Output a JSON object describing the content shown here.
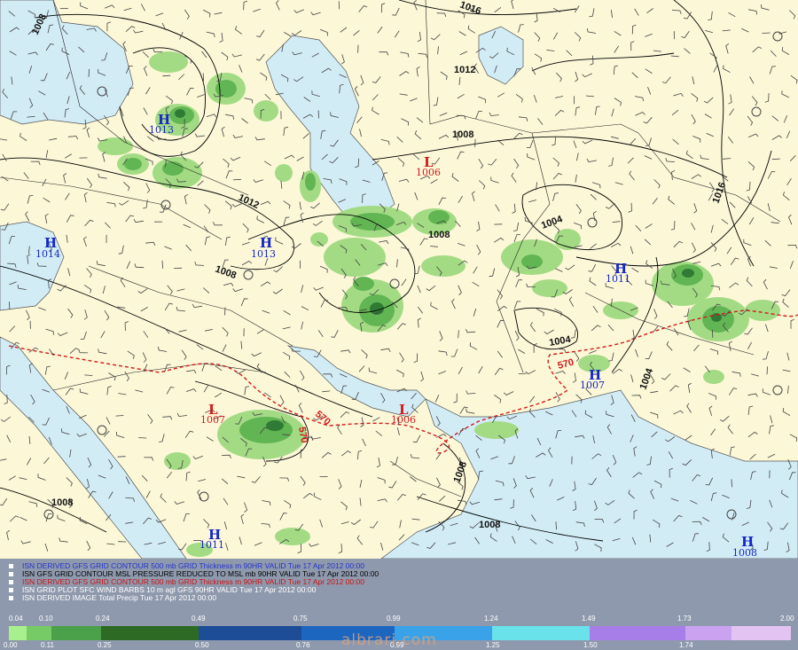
{
  "map": {
    "colors": {
      "land": "#fbf7d7",
      "sea": "#d2ecf6",
      "precip_light": "#a3db84",
      "precip_mid": "#62b553",
      "precip_dark": "#2f7a34",
      "high": "#1426c8",
      "low": "#d21a1a",
      "thickness_570": "#d21a1a"
    },
    "centers": [
      {
        "type": "H",
        "value": "1013"
      },
      {
        "type": "H",
        "value": "1014"
      },
      {
        "type": "H",
        "value": "1013"
      },
      {
        "type": "L",
        "value": "1006"
      },
      {
        "type": "H",
        "value": "1011"
      },
      {
        "type": "H",
        "value": "1007"
      },
      {
        "type": "L",
        "value": "1007"
      },
      {
        "type": "L",
        "value": "1006"
      },
      {
        "type": "H",
        "value": "1011"
      },
      {
        "type": "H",
        "value": "1008"
      }
    ],
    "isobar_labels": [
      "1016",
      "1008",
      "1012",
      "1008",
      "1012",
      "1008",
      "1008",
      "1004",
      "1016",
      "1004",
      "1004",
      "1008",
      "1008",
      "1008"
    ],
    "thickness_labels": [
      "570",
      "570",
      "570"
    ]
  },
  "legend": {
    "lines": [
      {
        "text": "ISN DERIVED GFS GRID CONTOUR 500 mb GRID Thickness m 90HR VALID Tue 17 Apr 2012 00:00",
        "color": "#2233cc"
      },
      {
        "text": "ISN GFS GRID CONTOUR MSL PRESSURE REDUCED TO MSL mb 90HR VALID Tue 17 Apr 2012 00:00",
        "color": "#000000"
      },
      {
        "text": "ISN DERIVED GFS GRID CONTOUR 500 mb GRID Thickness m 90HR VALID Tue 17 Apr 2012 00:00",
        "color": "#cc1111"
      },
      {
        "text": "ISN GRID PLOT SFC WIND BARBS 10 m agl GFS 90HR VALID Tue 17 Apr 2012 00:00",
        "color": "#ffffff"
      },
      {
        "text": "ISN DERIVED IMAGE Total Precip Tue 17 Apr 2012 00:00",
        "color": "#ffffff"
      }
    ],
    "scale_top": [
      "0.04",
      "0.10",
      "0.24",
      "0.49",
      "0.75",
      "0.99",
      "1.24",
      "1.49",
      "1.73",
      "2.00"
    ],
    "scale_bottom": [
      "0.00",
      "0.11",
      "0.25",
      "0.50",
      "0.76",
      "0.99",
      "1.25",
      "1.50",
      "1.74"
    ],
    "scale_colors": [
      "#a8ef8d",
      "#77cb66",
      "#4ba04a",
      "#2d6b24",
      "#1c4d96",
      "#1d66c0",
      "#3aa2e8",
      "#69e2e9",
      "#a77ee8",
      "#cba2ef",
      "#e2c3f1"
    ]
  },
  "watermark": "albrari.com"
}
